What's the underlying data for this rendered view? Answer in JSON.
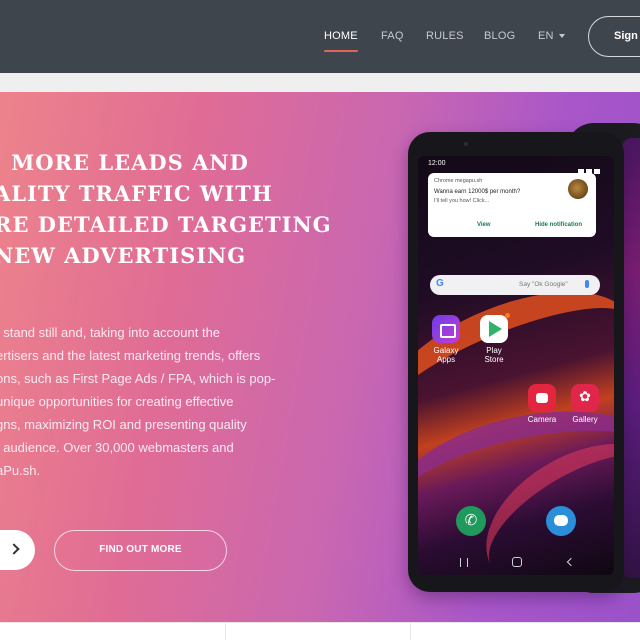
{
  "nav": {
    "items": [
      {
        "label": "HOME",
        "active": true
      },
      {
        "label": "FAQ",
        "active": false
      },
      {
        "label": "RULES",
        "active": false
      },
      {
        "label": "BLOG",
        "active": false
      }
    ],
    "language": "EN",
    "signin_label": "Sign i"
  },
  "hero": {
    "headline": [
      "; MORE LEADS AND",
      "ALITY TRAFFIC WITH",
      "RE DETAILED TARGETING",
      "NEW ADVERTISING"
    ],
    "description": [
      "t stand still and, taking into account the",
      "ertisers and the latest marketing trends, offers",
      "ons, such as First Page Ads / FPA, which is pop-",
      "unique opportunities for creating effective",
      "gns, maximizing ROI and presenting quality",
      "t audience. Over 30,000 webmasters and",
      "aPu.sh."
    ],
    "find_out_label": "FIND OUT MORE",
    "arrow_icon": "chevron-right-icon"
  },
  "phone": {
    "time": "12:00",
    "notification": {
      "app": "Chrome megapu.sh",
      "title": "Wanna earn 12000$ per month?",
      "body": "I'll tell you how! Click...",
      "view_label": "View",
      "hide_label": "Hide notification"
    },
    "search_hint": "Say \"Ok Google\"",
    "google_letter": "G",
    "apps": [
      {
        "line1": "Galaxy",
        "line2": "Apps"
      },
      {
        "line1": "Play",
        "line2": "Store"
      },
      {
        "line1": "Camera",
        "line2": ""
      },
      {
        "line1": "Gallery",
        "line2": ""
      }
    ]
  },
  "colors": {
    "nav_bg": "#3f454c",
    "active_underline": "#e2635a",
    "hero_gradient_start": "#ed838b",
    "hero_gradient_end": "#9a52c9"
  }
}
